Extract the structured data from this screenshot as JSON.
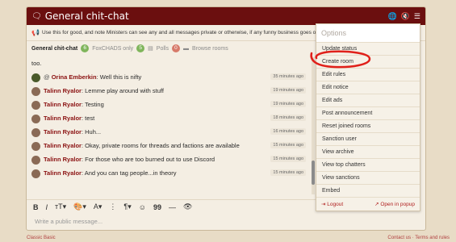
{
  "title_bar": {
    "title": "General chit-chat",
    "icons": [
      "chat-bubbles-icon",
      "globe-icon",
      "mute-icon",
      "menu-icon"
    ]
  },
  "notice": {
    "text": "Use this for good, and note Ministers can see any and all messages private or otherwise, if any funny business goes on, we"
  },
  "tabs": {
    "active": {
      "label": "General chit-chat",
      "count": "6"
    },
    "items": [
      {
        "label": "FoxCHADS only",
        "count": "5"
      },
      {
        "label": "Polls",
        "count": "0"
      },
      {
        "label": "Browse rooms"
      }
    ]
  },
  "messages": [
    {
      "avatar": "",
      "prefix": "",
      "name": "",
      "text": "too.",
      "time": ""
    },
    {
      "avatar": "dark",
      "prefix": "@",
      "name": "Orina Emberkin",
      "text": ": Well this is nifty",
      "time": "35 minutes ago"
    },
    {
      "avatar": "light",
      "prefix": "",
      "name": "Talinn Ryalor",
      "text": ": Lemme play around with stuff",
      "time": "19 minutes ago"
    },
    {
      "avatar": "light",
      "prefix": "",
      "name": "Talinn Ryalor",
      "text": ": Testing",
      "time": "19 minutes ago"
    },
    {
      "avatar": "light",
      "prefix": "",
      "name": "Talinn Ryalor",
      "text": ": test",
      "time": "18 minutes ago"
    },
    {
      "avatar": "light",
      "prefix": "",
      "name": "Talinn Ryalor",
      "text": ": Huh...",
      "time": "16 minutes ago"
    },
    {
      "avatar": "light",
      "prefix": "",
      "name": "Talinn Ryalor",
      "text": ": Okay, private rooms for threads and factions are available",
      "time": "15 minutes ago"
    },
    {
      "avatar": "light",
      "prefix": "",
      "name": "Talinn Ryalor",
      "text": ": For those who are too burned out to use Discord",
      "time": "15 minutes ago"
    },
    {
      "avatar": "light",
      "prefix": "",
      "name": "Talinn Ryalor",
      "text": ": And you can tag people...in theory",
      "time": "15 minutes ago"
    }
  ],
  "toolbar": {
    "bold": "B",
    "italic": "I",
    "text_size": "тT▾",
    "paint": "🎨▾",
    "color": "A▾",
    "more": "⋮",
    "paragraph": "¶▾",
    "emoji": "☺",
    "quote": "99",
    "rule": "—",
    "hide": "👁"
  },
  "composer": {
    "placeholder": "Write a public message..."
  },
  "options_menu": {
    "header": "Options",
    "items": [
      "Update status",
      "Create room",
      "Edit rules",
      "Edit notice",
      "Edit ads",
      "Post announcement",
      "Reset joined rooms",
      "Sanction user",
      "View archive",
      "View top chatters",
      "View sanctions",
      "Embed"
    ],
    "logout": "Logout",
    "popup": "Open in popup"
  },
  "footer": {
    "left": "Classic Basic",
    "right": "Contact us  ·  Terms and rules"
  },
  "colors": {
    "title_bar": "#6b0f0f",
    "name": "#8a1010",
    "annotation": "#e0201a"
  }
}
